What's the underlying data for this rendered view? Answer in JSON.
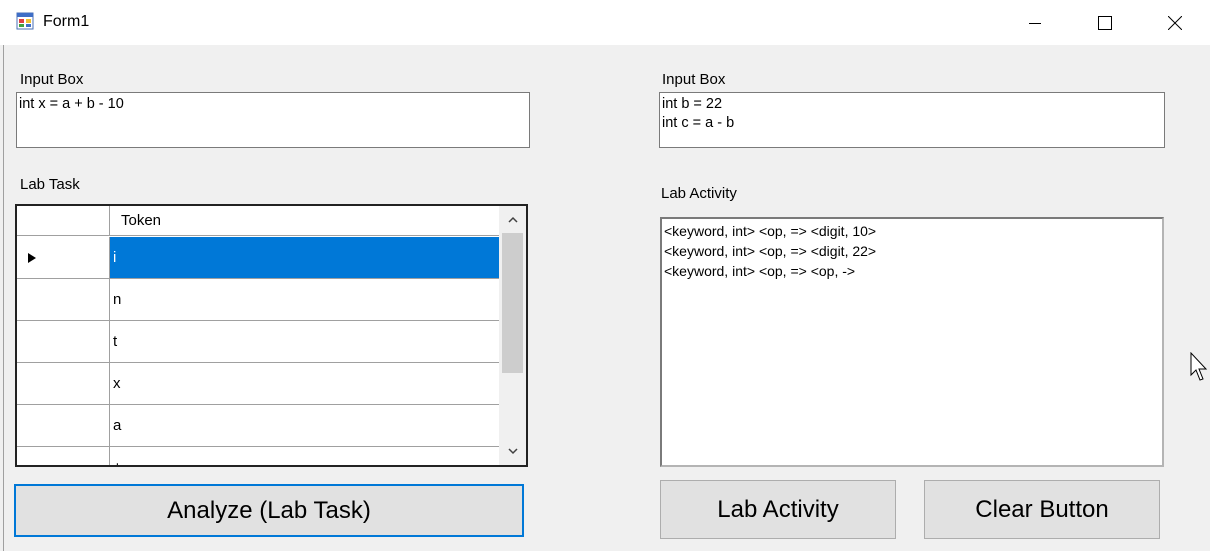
{
  "window": {
    "title": "Form1"
  },
  "left": {
    "input_label": "Input Box",
    "input_value": "int x = a + b - 10",
    "grid_label": "Lab Task",
    "grid": {
      "columns": [
        "Token"
      ],
      "rows": [
        "i",
        "n",
        "t",
        "x",
        "a",
        "+"
      ]
    },
    "analyze_button": "Analyze (Lab Task)"
  },
  "right": {
    "input_label": "Input Box",
    "input_value": "int b = 22\nint c = a - b",
    "output_label": "Lab Activity",
    "output_value": "<keyword, int> <op, => <digit, 10>\n<keyword, int> <op, => <digit, 22>\n<keyword, int> <op, => <op, ->",
    "lab_activity_button": "Lab Activity",
    "clear_button": "Clear Button"
  },
  "colors": {
    "selection": "#0078d7",
    "window_bg": "#f0f0f0"
  },
  "icons": {
    "app": "form-app-icon",
    "minimize": "minimize-icon",
    "maximize": "maximize-icon",
    "close": "close-icon",
    "row_indicator": "current-row-arrow-icon",
    "scroll_up": "chevron-up-icon",
    "scroll_down": "chevron-down-icon",
    "cursor": "mouse-pointer-icon"
  }
}
